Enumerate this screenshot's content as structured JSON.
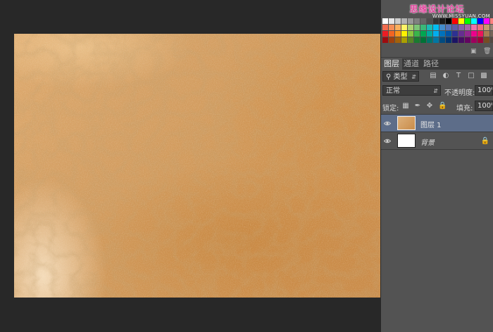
{
  "watermark": {
    "text": "思缘设计论坛",
    "url": "WWW.MISSYUAN.COM"
  },
  "swatch_colors": [
    [
      "#ffffff",
      "#e6e6e6",
      "#ccc",
      "#b3b3b3",
      "#999",
      "#808080",
      "#666",
      "#4d4d4d",
      "#333",
      "#1a1a1a",
      "#000",
      "#ff0000",
      "#ffff00",
      "#00ff00",
      "#00ffff",
      "#0000ff",
      "#ff00ff",
      "#ff8080"
    ],
    [
      "#f26c4f",
      "#f68e56",
      "#fbaf5d",
      "#fff467",
      "#acd372",
      "#7cc576",
      "#3bb878",
      "#1abbb4",
      "#00bff3",
      "#438ccb",
      "#5574b9",
      "#605ca8",
      "#855fa8",
      "#a763a8",
      "#f06ea9",
      "#f26d7d",
      "#c69c6d",
      "#998675"
    ],
    [
      "#ed1c24",
      "#f26522",
      "#f7941d",
      "#fff200",
      "#8dc63f",
      "#39b54a",
      "#00a651",
      "#00a99d",
      "#00aeef",
      "#0072bc",
      "#0054a6",
      "#2e3192",
      "#662d91",
      "#92278f",
      "#ec008c",
      "#ed145b",
      "#a67c52",
      "#736357"
    ],
    [
      "#9e0b0f",
      "#a0410d",
      "#a3620a",
      "#aba000",
      "#598527",
      "#1a7b30",
      "#007236",
      "#00746b",
      "#0076a3",
      "#004b80",
      "#003471",
      "#1b1464",
      "#440e62",
      "#630460",
      "#9e005d",
      "#9e0039",
      "#754c24",
      "#534741"
    ]
  ],
  "tabs": [
    "图层",
    "通道",
    "路径"
  ],
  "filter": {
    "kind_label": "类型",
    "icons": [
      "image-filter-icon",
      "adjustment-filter-icon",
      "type-filter-icon",
      "shape-filter-icon",
      "smart-object-filter-icon"
    ]
  },
  "blend": {
    "mode": "正常",
    "opacity_label": "不透明度:",
    "opacity_value": "100%"
  },
  "lock": {
    "label": "锁定:",
    "fill_label": "填充:",
    "fill_value": "100%"
  },
  "layers": [
    {
      "name": "图层 1",
      "selected": true,
      "visible": true,
      "locked": false
    },
    {
      "name": "背景",
      "selected": false,
      "visible": true,
      "locked": true
    }
  ],
  "colors": {
    "panel_bg": "#535353",
    "canvas_bg": "#282828",
    "selected_layer": "#5d6d89",
    "leather_base": "#d49f63",
    "watermark": "#e0409a"
  }
}
